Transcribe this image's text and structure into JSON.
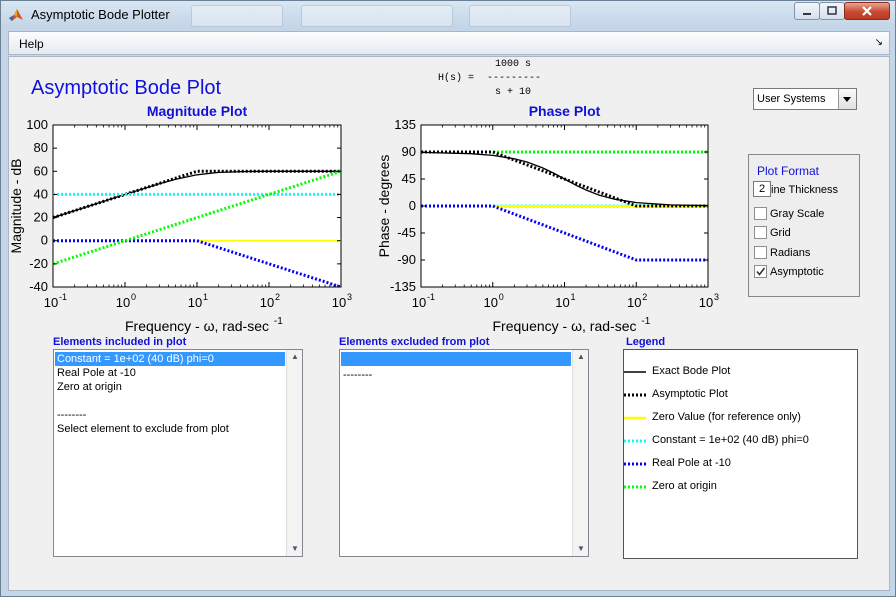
{
  "window": {
    "title": "Asymptotic Bode Plotter",
    "menu": [
      "Help"
    ]
  },
  "app": {
    "main_title": "Asymptotic Bode Plot",
    "transfer_function": {
      "lhs": "H(s) =",
      "numerator": "1000 s",
      "denominator": "s + 10",
      "bar": "---------"
    }
  },
  "controls": {
    "system_select": {
      "value": "User Systems"
    },
    "plot_format": {
      "title": "Plot Format",
      "line_thickness_value": "2",
      "line_thickness_label": "ine Thickness",
      "checkboxes": [
        {
          "label": "Gray Scale",
          "checked": false
        },
        {
          "label": "Grid",
          "checked": false
        },
        {
          "label": "Radians",
          "checked": false
        },
        {
          "label": "Asymptotic",
          "checked": true
        }
      ]
    }
  },
  "lists": {
    "included": {
      "label": "Elements included in plot",
      "items": [
        "Constant = 1e+02 (40 dB) phi=0",
        "Real Pole at -10",
        "Zero at origin",
        "",
        "--------",
        "Select element to exclude from plot"
      ],
      "selected_index": 0
    },
    "excluded": {
      "label": "Elements excluded from plot",
      "items": [
        "",
        "--------"
      ],
      "selected_index": 0
    }
  },
  "legend": {
    "title": "Legend",
    "entries": [
      {
        "label": "Exact Bode Plot",
        "color": "#000000",
        "style": "solid"
      },
      {
        "label": "Asymptotic Plot",
        "color": "#000000",
        "style": "dotted"
      },
      {
        "label": "Zero Value (for reference only)",
        "color": "#ffff00",
        "style": "solid"
      },
      {
        "label": "Constant = 1e+02 (40 dB) phi=0",
        "color": "#00ffff",
        "style": "dotted"
      },
      {
        "label": "Real Pole at -10",
        "color": "#0000ff",
        "style": "dotted"
      },
      {
        "label": "Zero at origin",
        "color": "#00ff00",
        "style": "dotted"
      }
    ]
  },
  "chart_data": [
    {
      "type": "line",
      "title": "Magnitude Plot",
      "xlabel": "Frequency - ω, rad-sec⁻¹",
      "ylabel": "Magnitude - dB",
      "x_scale": "log",
      "xlim": [
        0.1,
        1000
      ],
      "ylim": [
        -40,
        100
      ],
      "xticks": [
        0.1,
        1,
        10,
        100,
        1000
      ],
      "xtick_labels": [
        [
          "10",
          "-1"
        ],
        [
          "10",
          "0"
        ],
        [
          "10",
          "1"
        ],
        [
          "10",
          "2"
        ],
        [
          "10",
          "3"
        ]
      ],
      "yticks": [
        -40,
        -20,
        0,
        20,
        40,
        60,
        80,
        100
      ],
      "grid": false,
      "series": [
        {
          "name": "Exact Bode Plot",
          "color": "#000000",
          "style": "solid",
          "x": [
            0.1,
            0.3,
            1,
            3,
            5,
            10,
            20,
            50,
            100,
            1000
          ],
          "y": [
            20,
            29.5,
            40,
            49.2,
            53,
            57,
            59,
            59.8,
            60,
            60
          ]
        },
        {
          "name": "Asymptotic Plot",
          "color": "#000000",
          "style": "dotted",
          "x": [
            0.1,
            10,
            1000
          ],
          "y": [
            20,
            60,
            60
          ]
        },
        {
          "name": "Zero Value (for reference only)",
          "color": "#ffff00",
          "style": "solid",
          "x": [
            10,
            1000
          ],
          "y": [
            0,
            0
          ]
        },
        {
          "name": "Constant = 1e+02 (40 dB) phi=0",
          "color": "#00ffff",
          "style": "dotted",
          "x": [
            0.1,
            1000
          ],
          "y": [
            40,
            40
          ]
        },
        {
          "name": "Real Pole at -10",
          "color": "#0000ff",
          "style": "dotted",
          "x": [
            0.1,
            10,
            1000
          ],
          "y": [
            0,
            0,
            -40
          ]
        },
        {
          "name": "Zero at origin",
          "color": "#00ff00",
          "style": "dotted",
          "x": [
            0.1,
            1000
          ],
          "y": [
            -20,
            60
          ]
        }
      ]
    },
    {
      "type": "line",
      "title": "Phase Plot",
      "xlabel": "Frequency - ω, rad-sec⁻¹",
      "ylabel": "Phase - degrees",
      "x_scale": "log",
      "xlim": [
        0.1,
        1000
      ],
      "ylim": [
        -135,
        135
      ],
      "xticks": [
        0.1,
        1,
        10,
        100,
        1000
      ],
      "xtick_labels": [
        [
          "10",
          "-1"
        ],
        [
          "10",
          "0"
        ],
        [
          "10",
          "1"
        ],
        [
          "10",
          "2"
        ],
        [
          "10",
          "3"
        ]
      ],
      "yticks": [
        -135,
        -90,
        -45,
        0,
        45,
        90,
        135
      ],
      "grid": false,
      "series": [
        {
          "name": "Zero at origin",
          "color": "#00ff00",
          "style": "dotted",
          "x": [
            0.1,
            1000
          ],
          "y": [
            90,
            90
          ]
        },
        {
          "name": "Constant = 1e+02 (40 dB) phi=0",
          "color": "#00ffff",
          "style": "dotted",
          "x": [
            1,
            1000
          ],
          "y": [
            0,
            0
          ]
        },
        {
          "name": "Zero Value (for reference only)",
          "color": "#ffff00",
          "style": "solid",
          "x": [
            1,
            1000
          ],
          "y": [
            0,
            0
          ]
        },
        {
          "name": "Exact Bode Plot",
          "color": "#000000",
          "style": "solid",
          "x": [
            0.1,
            0.5,
            1,
            2,
            3,
            5,
            7,
            10,
            15,
            20,
            30,
            50,
            100,
            300,
            1000
          ],
          "y": [
            89.4,
            87.1,
            84.3,
            78.7,
            73.3,
            63.4,
            55,
            45,
            33.7,
            26.6,
            18.4,
            11.3,
            5.7,
            1.9,
            0.6
          ]
        },
        {
          "name": "Real Pole at -10",
          "color": "#0000ff",
          "style": "dotted",
          "x": [
            0.1,
            1,
            100,
            1000
          ],
          "y": [
            0,
            0,
            -90,
            -90
          ]
        },
        {
          "name": "Asymptotic Plot",
          "color": "#000000",
          "style": "dotted",
          "x": [
            0.1,
            1,
            100,
            1000
          ],
          "y": [
            90,
            90,
            0,
            0
          ]
        }
      ]
    }
  ]
}
